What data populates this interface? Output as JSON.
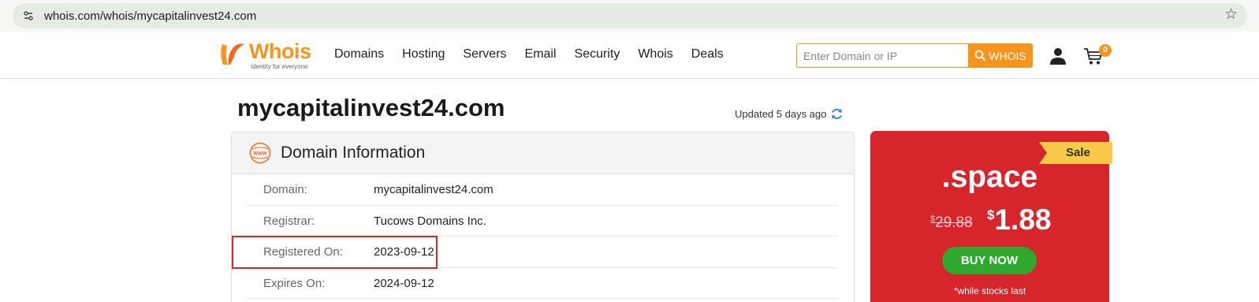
{
  "browser": {
    "url": "whois.com/whois/mycapitalinvest24.com"
  },
  "header": {
    "logo_word": "Whois",
    "logo_tagline": "Identity for everyone",
    "nav": [
      "Domains",
      "Hosting",
      "Servers",
      "Email",
      "Security",
      "Whois",
      "Deals"
    ],
    "search_placeholder": "Enter Domain or IP",
    "search_button": "WHOIS",
    "cart_count": "0"
  },
  "main": {
    "domain": "mycapitalinvest24.com",
    "updated": "Updated 5 days ago",
    "info_title": "Domain Information",
    "rows": [
      {
        "label": "Domain:",
        "value": "mycapitalinvest24.com"
      },
      {
        "label": "Registrar:",
        "value": "Tucows Domains Inc."
      },
      {
        "label": "Registered On:",
        "value": "2023-09-12"
      },
      {
        "label": "Expires On:",
        "value": "2024-09-12"
      }
    ]
  },
  "promo": {
    "badge": "Sale",
    "tld": ".space",
    "old_currency": "$",
    "old_price": "29.88",
    "new_currency": "$",
    "new_price": "1.88",
    "button": "BUY NOW",
    "note": "*while stocks last"
  },
  "colors": {
    "brand_orange": "#f7941d",
    "promo_red": "#d6262b",
    "buy_green": "#2fa82e",
    "highlight_red": "#e02424"
  }
}
